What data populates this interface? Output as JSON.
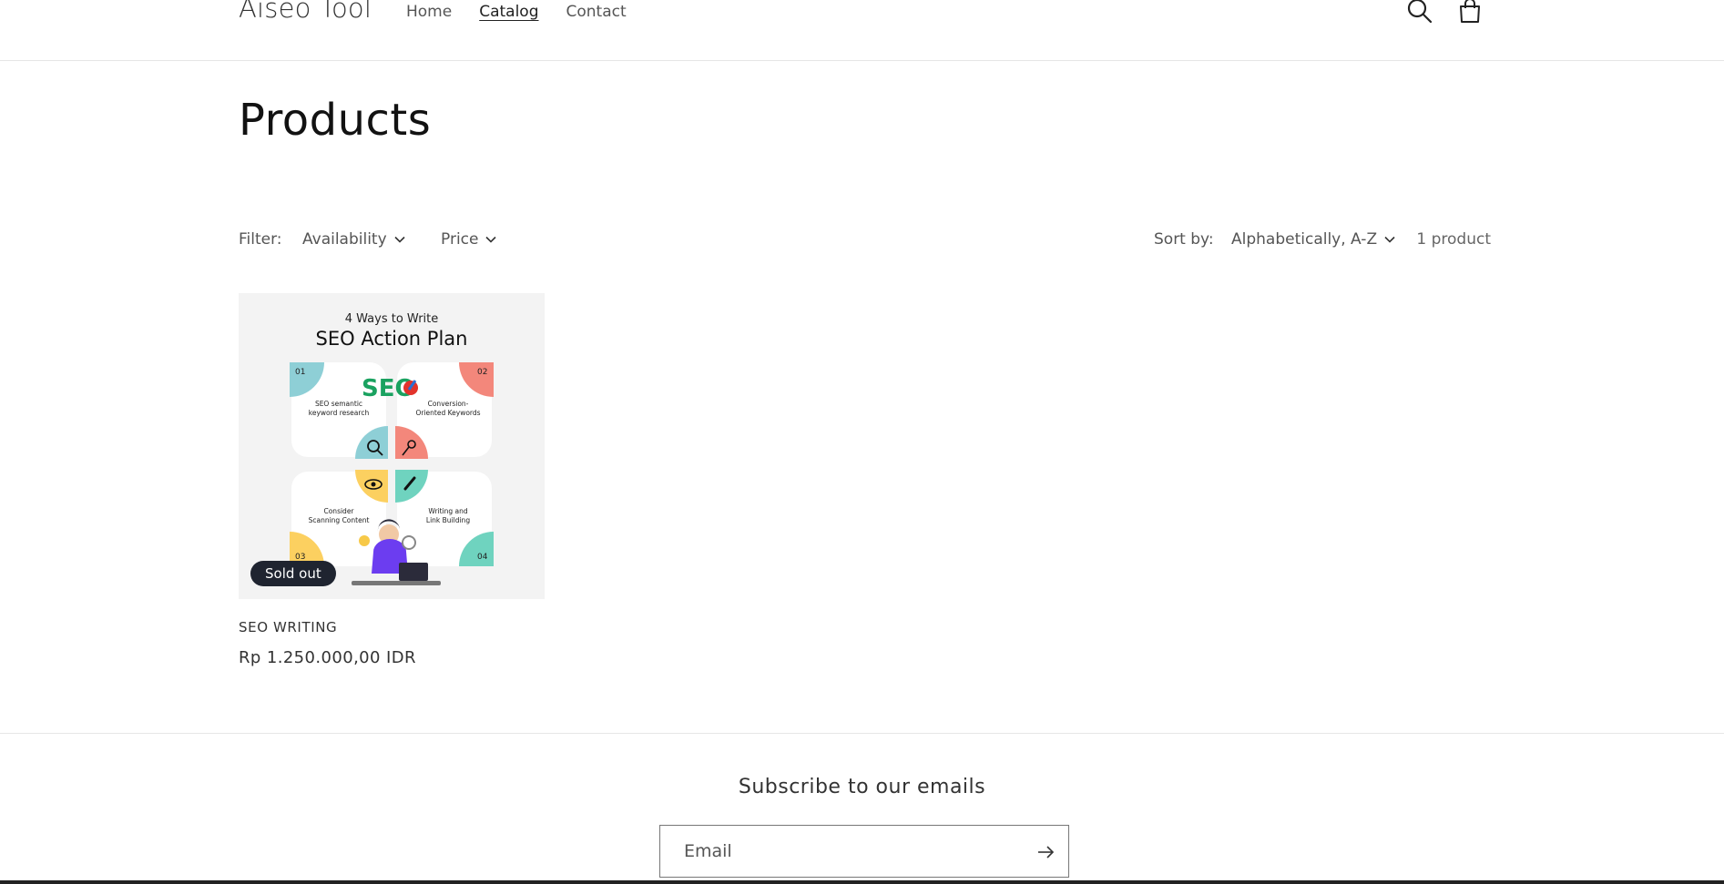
{
  "header": {
    "logo": "Aiseo Tool",
    "nav": [
      {
        "label": "Home"
      },
      {
        "label": "Catalog"
      },
      {
        "label": "Contact"
      }
    ],
    "icons": [
      "search-icon",
      "cart-icon"
    ]
  },
  "page": {
    "title": "Products"
  },
  "filters": {
    "filter_label": "Filter:",
    "availability_label": "Availability",
    "price_label": "Price",
    "sort_label": "Sort by:",
    "sort_value": "Alphabetically, A-Z",
    "product_count": "1 product"
  },
  "products": [
    {
      "title": "SEO WRITING",
      "price": "Rp 1.250.000,00 IDR",
      "badge": "Sold out",
      "image": {
        "heading_small": "4 Ways to Write",
        "heading_large": "SEO Action Plan",
        "logo_text": "SEO",
        "steps": [
          {
            "num": "01",
            "line1": "SEO semantic",
            "line2": "keyword  research"
          },
          {
            "num": "02",
            "line1": "Conversion-",
            "line2": "Oriented Keywords"
          },
          {
            "num": "03",
            "line1": "Consider",
            "line2": "Scanning Content"
          },
          {
            "num": "04",
            "line1": "Writing and",
            "line2": "Link Building"
          }
        ],
        "colors": {
          "teal": "#8ecfd6",
          "coral": "#f3877b",
          "yellow": "#fcd060",
          "mint": "#6fd3bf"
        }
      }
    }
  ],
  "footer": {
    "subscribe_title": "Subscribe to our emails",
    "email_placeholder": "Email"
  }
}
